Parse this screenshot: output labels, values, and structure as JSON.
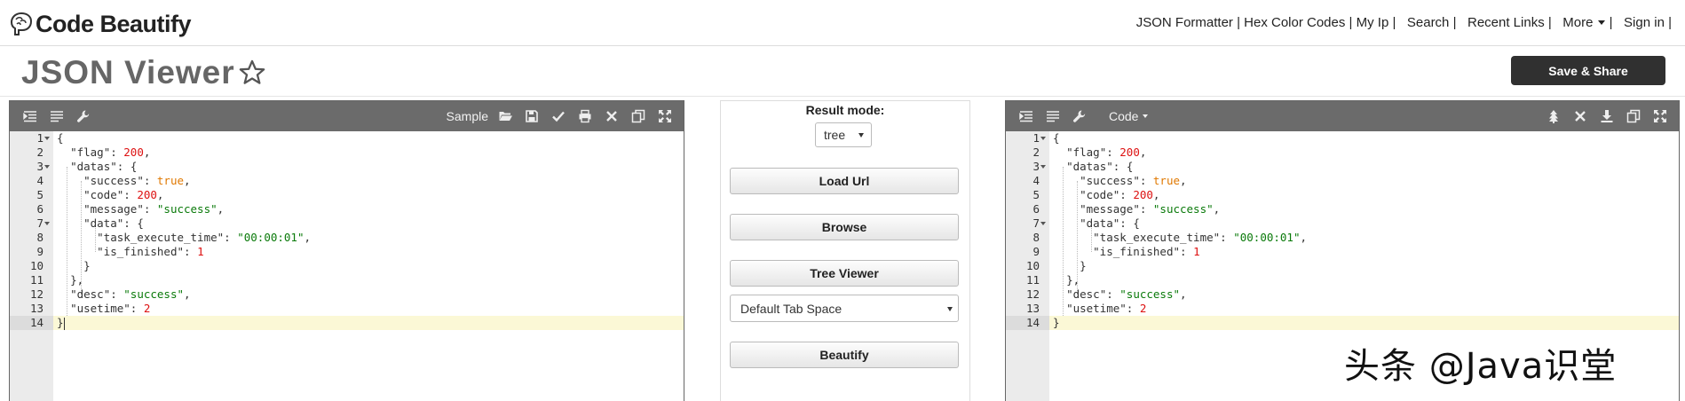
{
  "header": {
    "logo_text": "Code Beautify",
    "nav": [
      {
        "label": "JSON Formatter",
        "sep": " | "
      },
      {
        "label": "Hex Color Codes",
        "sep": " | "
      },
      {
        "label": "My Ip",
        "sep": " |   "
      },
      {
        "label": "Search",
        "sep": " |   "
      },
      {
        "label": "Recent Links",
        "sep": " |   "
      },
      {
        "label": "More",
        "sep": " |   "
      },
      {
        "label": "Sign in",
        "sep": " |"
      }
    ]
  },
  "title_row": {
    "title": "JSON Viewer",
    "share_label": "Save & Share"
  },
  "left_panel": {
    "sample_label": "Sample",
    "lines": [
      {
        "n": "1",
        "fold": true
      },
      {
        "n": "2"
      },
      {
        "n": "3",
        "fold": true
      },
      {
        "n": "4"
      },
      {
        "n": "5"
      },
      {
        "n": "6"
      },
      {
        "n": "7",
        "fold": true
      },
      {
        "n": "8"
      },
      {
        "n": "9"
      },
      {
        "n": "10"
      },
      {
        "n": "11"
      },
      {
        "n": "12"
      },
      {
        "n": "13"
      },
      {
        "n": "14"
      }
    ]
  },
  "right_panel": {
    "code_label": "Code"
  },
  "json_text": {
    "l1": "{",
    "flag_key": "\"flag\"",
    "flag_val": "200",
    "datas_key": "\"datas\"",
    "open": "{",
    "success_key": "\"success\"",
    "success_val": "true",
    "code_key": "\"code\"",
    "code_val": "200",
    "message_key": "\"message\"",
    "message_val": "\"success\"",
    "data_key": "\"data\"",
    "task_key": "\"task_execute_time\"",
    "task_val": "\"00:00:01\"",
    "finished_key": "\"is_finished\"",
    "finished_val": "1",
    "close": "}",
    "close_comma": "},",
    "desc_key": "\"desc\"",
    "desc_val": "\"success\"",
    "usetime_key": "\"usetime\"",
    "usetime_val": "2",
    "end": "}"
  },
  "middle": {
    "result_mode_label": "Result mode:",
    "result_mode_value": "tree",
    "buttons": [
      "Load Url",
      "Browse",
      "Tree Viewer",
      "Beautify"
    ],
    "tab_space_value": "Default Tab Space"
  },
  "watermark": "头条 @Java识堂"
}
